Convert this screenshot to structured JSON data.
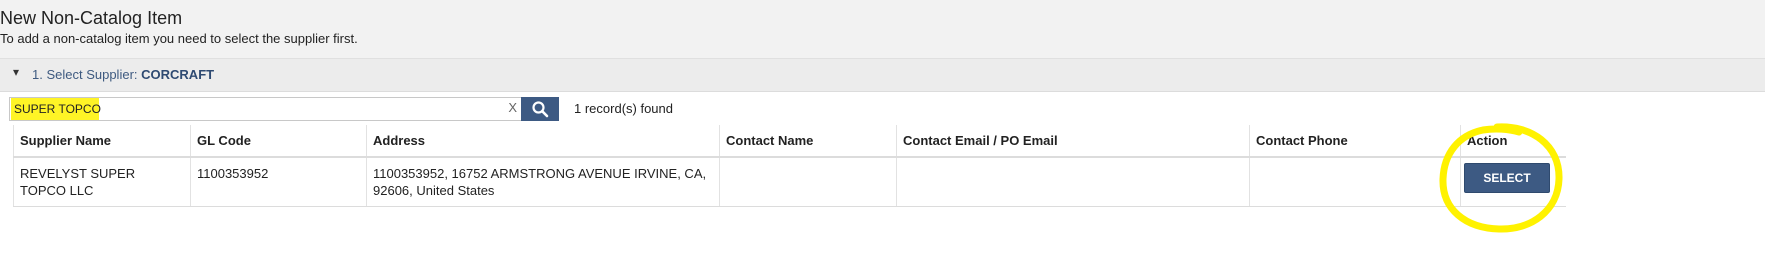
{
  "header": {
    "title": "New Non-Catalog Item",
    "subtitle": "To add a non-catalog item you need to select the supplier first."
  },
  "step": {
    "label": "1. Select Supplier:",
    "value": "CORCRAFT"
  },
  "search": {
    "value": "SUPER TOPCO",
    "clear_label": "X",
    "result_count": "1 record(s) found"
  },
  "table": {
    "columns": [
      "Supplier Name",
      "GL Code",
      "Address",
      "Contact Name",
      "Contact Email / PO Email",
      "Contact Phone",
      "Action"
    ],
    "rows": [
      {
        "supplier_name": "REVELYST SUPER TOPCO LLC",
        "gl_code": "1100353952",
        "address": "1100353952, 16752 ARMSTRONG AVENUE IRVINE, CA, 92606, United States",
        "contact_name": "",
        "contact_email": "",
        "contact_phone": "",
        "action_label": "SELECT"
      }
    ]
  },
  "colors": {
    "accent": "#3d5a83",
    "highlight": "#fff200"
  }
}
